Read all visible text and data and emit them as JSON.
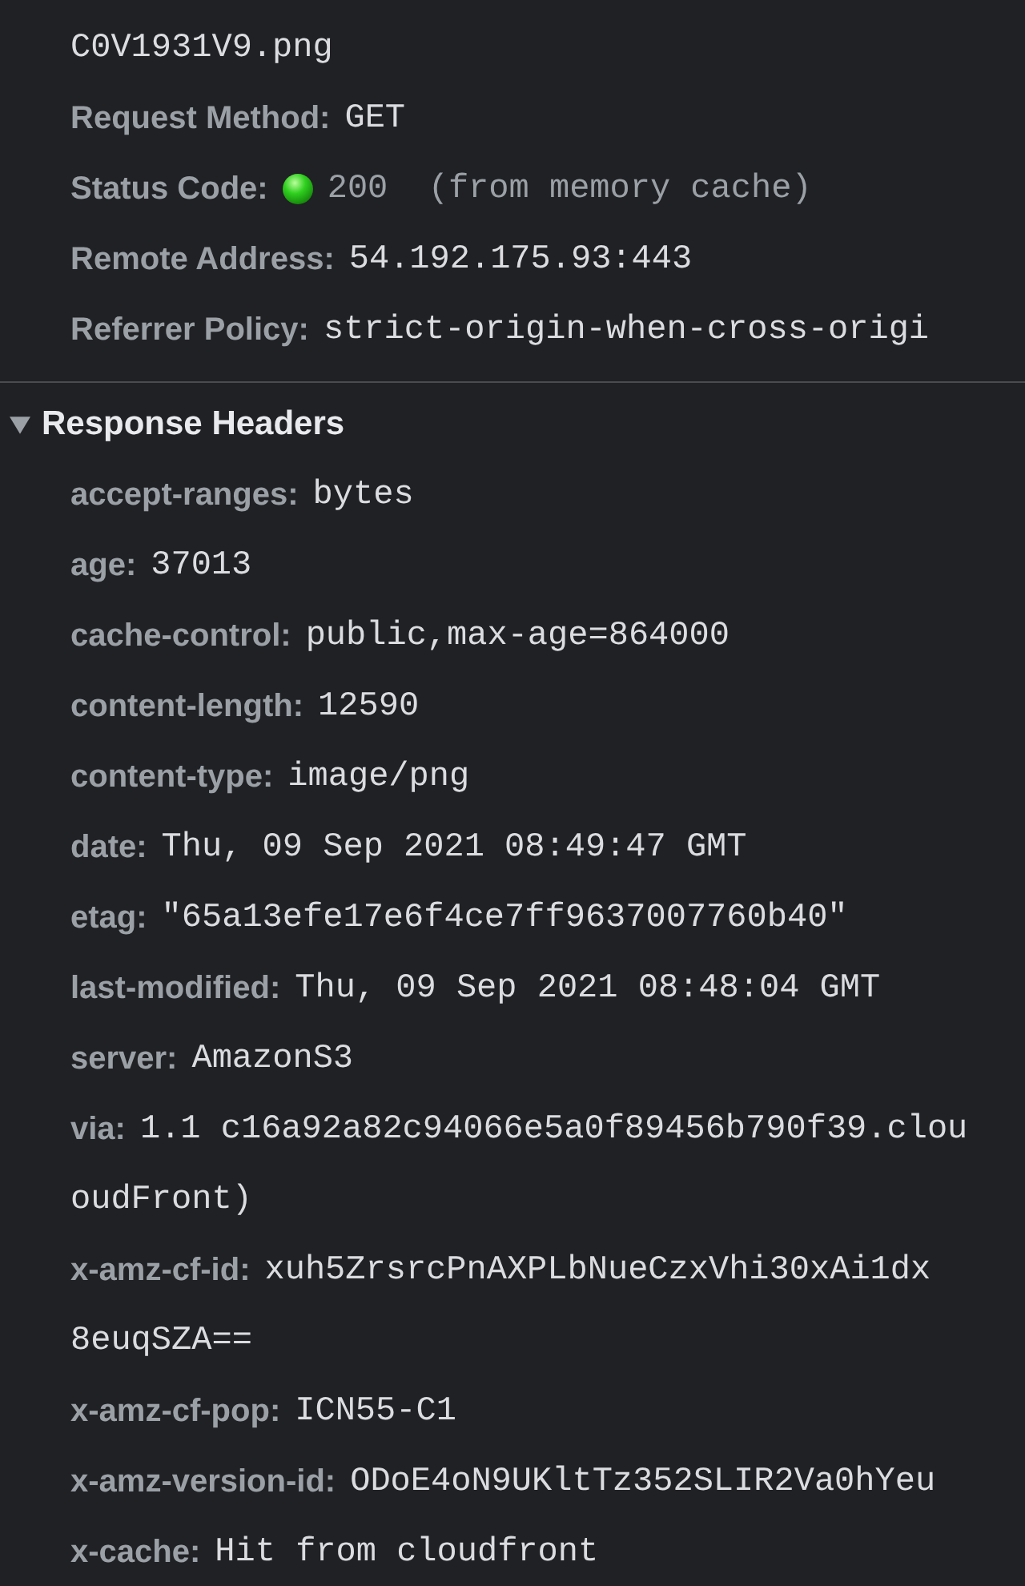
{
  "general": {
    "rows": [
      {
        "kind": "plain",
        "value": "C0V1931V9.png"
      },
      {
        "kind": "plain",
        "key": "Request Method:",
        "value": "GET"
      },
      {
        "kind": "status",
        "key": "Status Code:",
        "value": "200  (from memory cache)"
      },
      {
        "kind": "plain",
        "key": "Remote Address:",
        "value": "54.192.175.93:443"
      },
      {
        "kind": "plain",
        "key": "Referrer Policy:",
        "value": "strict-origin-when-cross-origi"
      }
    ]
  },
  "response_headers": {
    "title": "Response Headers",
    "expanded": true,
    "rows": [
      {
        "key": "accept-ranges:",
        "value": "bytes"
      },
      {
        "key": "age:",
        "value": "37013"
      },
      {
        "key": "cache-control:",
        "value": "public,max-age=864000"
      },
      {
        "key": "content-length:",
        "value": "12590"
      },
      {
        "key": "content-type:",
        "value": "image/png"
      },
      {
        "key": "date:",
        "value": "Thu, 09 Sep 2021 08:49:47 GMT"
      },
      {
        "key": "etag:",
        "value": "\"65a13efe17e6f4ce7ff9637007760b40\""
      },
      {
        "key": "last-modified:",
        "value": "Thu, 09 Sep 2021 08:48:04 GMT"
      },
      {
        "key": "server:",
        "value": "AmazonS3"
      },
      {
        "key": "via:",
        "value": "1.1 c16a92a82c94066e5a0f89456b790f39.clou",
        "continuation": "oudFront)"
      },
      {
        "key": "x-amz-cf-id:",
        "value": "xuh5ZrsrcPnAXPLbNueCzxVhi30xAi1dx",
        "continuation": "8euqSZA=="
      },
      {
        "key": "x-amz-cf-pop:",
        "value": "ICN55-C1"
      },
      {
        "key": "x-amz-version-id:",
        "value": "ODoE4oN9UKltTz352SLIR2Va0hYeu"
      },
      {
        "key": "x-cache:",
        "value": "Hit from cloudfront"
      }
    ]
  }
}
